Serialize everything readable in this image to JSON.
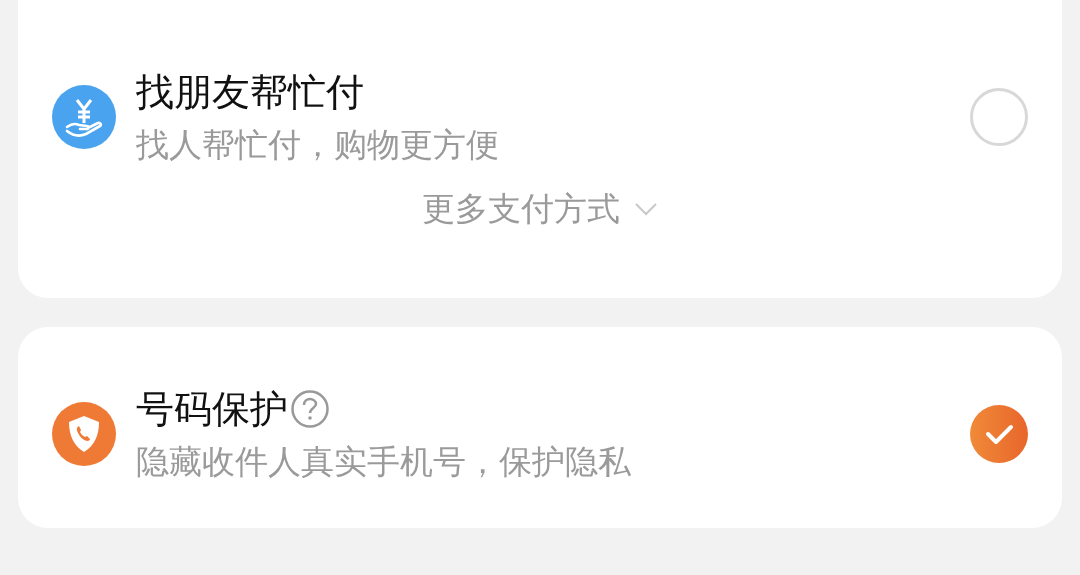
{
  "payment_options": {
    "items": [
      {
        "title": "找朋友帮忙付",
        "subtitle": "找人帮忙付，购物更方便",
        "selected": false
      }
    ],
    "more_button": {
      "label": "更多支付方式"
    }
  },
  "number_protection": {
    "title": "号码保护",
    "subtitle": "隐藏收件人真实手机号，保护隐私",
    "checked": true
  }
}
